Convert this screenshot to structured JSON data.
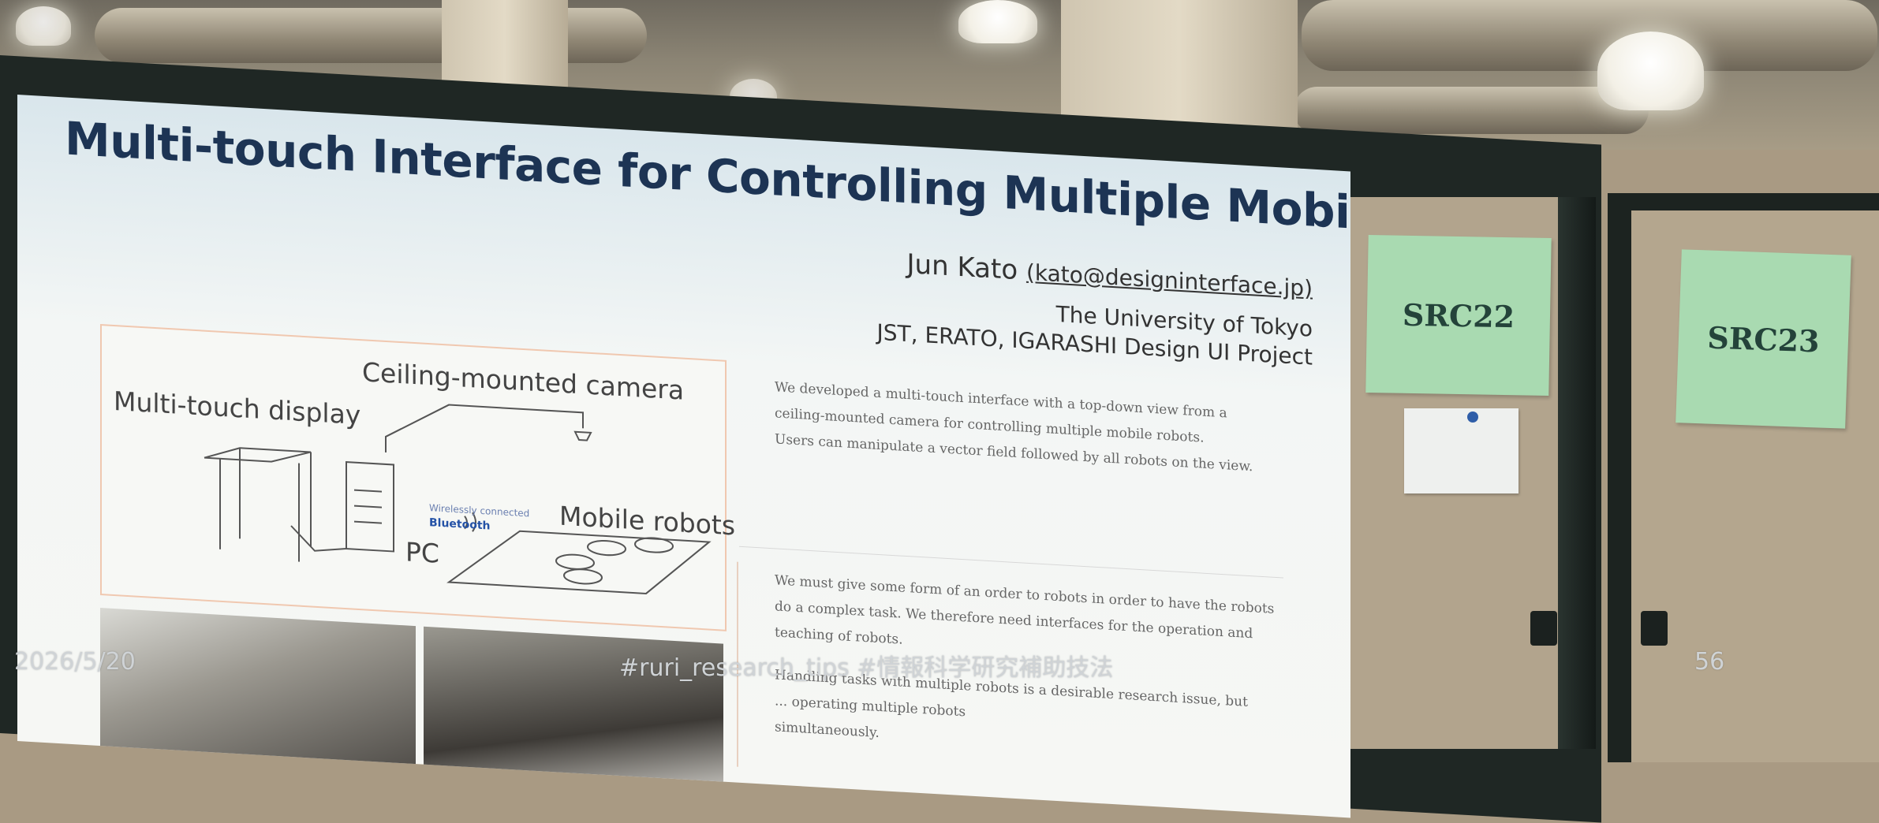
{
  "poster": {
    "title": "Multi-touch Interface for Controlling Multiple Mobile Robots",
    "author": "Jun Kato",
    "email": "(kato@designinterface.jp)",
    "affiliation_1": "The University of Tokyo",
    "affiliation_2": "JST, ERATO, IGARASHI Design UI Project",
    "diagram": {
      "ceiling_camera": "Ceiling-mounted camera",
      "multi_touch_display": "Multi-touch display",
      "wireless": "Wirelessly connected",
      "bluetooth": "Bluetooth",
      "mobile_robots": "Mobile robots",
      "pc": "PC"
    },
    "para_1_lines": [
      "We developed a multi-touch interface with a top-down view from a",
      "ceiling-mounted camera for controlling multiple mobile robots.",
      "Users can manipulate a vector field followed by all robots on the view."
    ],
    "para_2_lines": [
      "We must give some form of an order to robots in order to have the robots",
      "do a complex task. We therefore need interfaces for the operation and",
      "teaching of robots."
    ],
    "para_3_lines": [
      "Handling tasks with multiple robots is a desirable research issue, but",
      "... operating multiple robots",
      "simultaneously."
    ]
  },
  "notes": {
    "src22": "SRC22",
    "src23": "SRC23"
  },
  "footer": {
    "date": "2026/5/20",
    "hashtags": "#ruri_research_tips #情報科学研究補助技法",
    "page_number": "56"
  }
}
